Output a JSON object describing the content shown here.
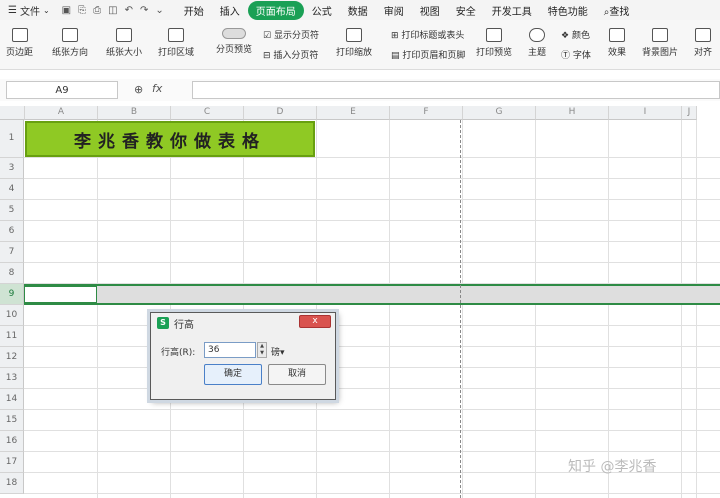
{
  "menubar": {
    "file_label": "文件",
    "tabs": [
      "开始",
      "插入",
      "页面布局",
      "公式",
      "数据",
      "审阅",
      "视图",
      "安全",
      "开发工具",
      "特色功能",
      "查找"
    ],
    "active_tab": "页面布局"
  },
  "ribbon": {
    "margins": "页边距",
    "orientation": "纸张方向",
    "size": "纸张大小",
    "print_area": "打印区域",
    "page_preview": "分页预览",
    "show_breaks": "显示分页符",
    "insert_break": "插入分页符",
    "print_scale": "打印缩放",
    "print_titles": "打印标题或表头",
    "print_header_footer": "打印页眉和页脚",
    "print_preview": "打印预览",
    "theme": "主题",
    "colors": "颜色",
    "fonts": "字体",
    "effects": "效果",
    "background": "背景图片",
    "align": "对齐"
  },
  "formula_bar": {
    "name_box": "A9",
    "fx": "fx",
    "value": ""
  },
  "columns": [
    "A",
    "B",
    "C",
    "D",
    "E",
    "F",
    "G",
    "H",
    "I",
    "J"
  ],
  "rows": [
    "1",
    "3",
    "4",
    "5",
    "6",
    "7",
    "8",
    "9",
    "10",
    "11",
    "12",
    "13",
    "14",
    "15",
    "16",
    "17",
    "18"
  ],
  "title_cell": "李兆香教你做表格",
  "dialog": {
    "title": "行高",
    "icon": "S",
    "close": "x",
    "label": "行高(R):",
    "value": "36",
    "unit": "磅",
    "ok": "确定",
    "cancel": "取消"
  },
  "watermark": "知乎 @李兆香",
  "colors": {
    "accent": "#1aa055",
    "title_fill": "#8fc924",
    "selection": "#2e8b45"
  }
}
